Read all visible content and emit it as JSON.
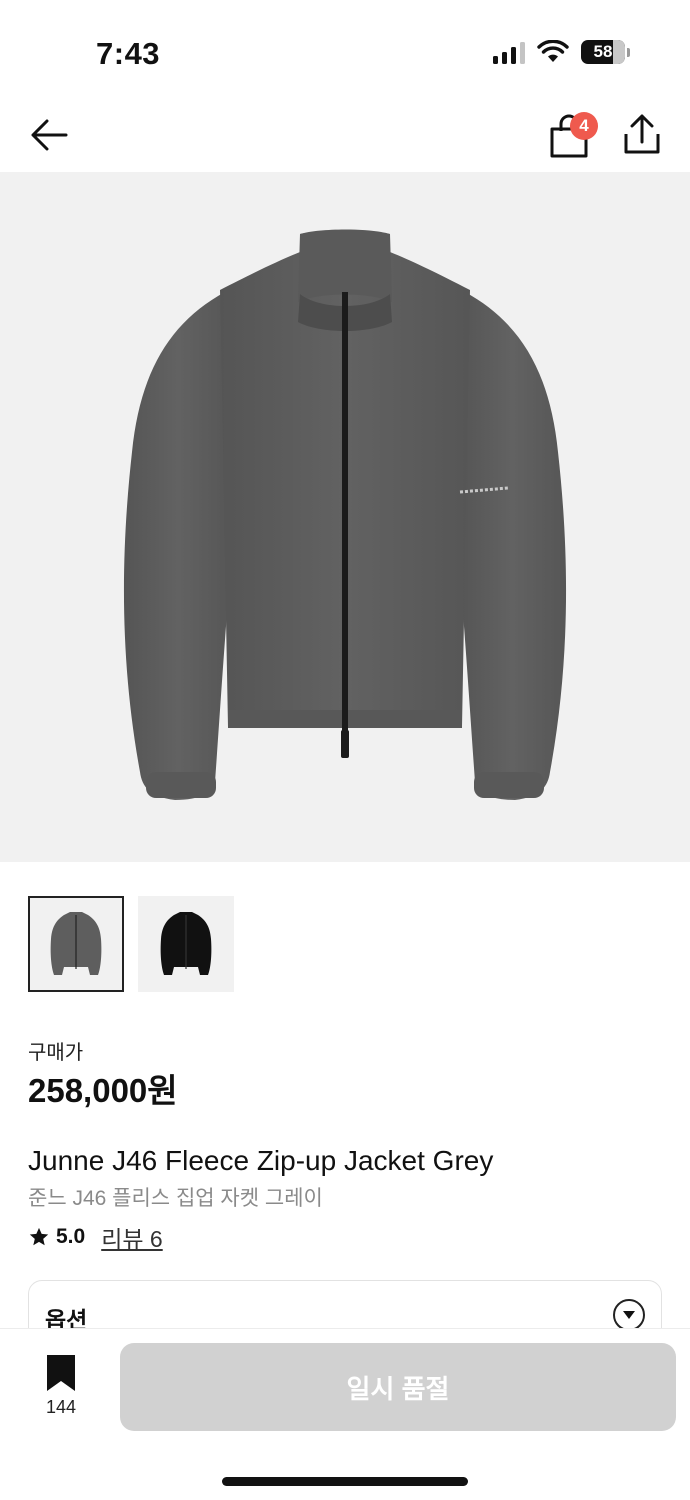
{
  "status_bar": {
    "time": "7:43",
    "battery": "58"
  },
  "nav": {
    "bag_count": "4"
  },
  "product": {
    "price_label": "구매가",
    "price": "258,000원",
    "name_en": "Junne J46 Fleece Zip-up Jacket Grey",
    "name_ko": "준느 J46 플리스 집업 자켓 그레이",
    "rating": "5.0",
    "review_label": "리뷰 6"
  },
  "thumbnails": [
    {
      "color": "#5e5e5e",
      "selected": true
    },
    {
      "color": "#111111",
      "selected": false
    }
  ],
  "options": {
    "label": "옵션"
  },
  "bottom_bar": {
    "wish_count": "144",
    "buy_button_label": "일시 품절"
  },
  "colors": {
    "badge": "#ef5a4e",
    "disabled_button": "#d1d1d1",
    "jacket": "#5e5e5e"
  }
}
